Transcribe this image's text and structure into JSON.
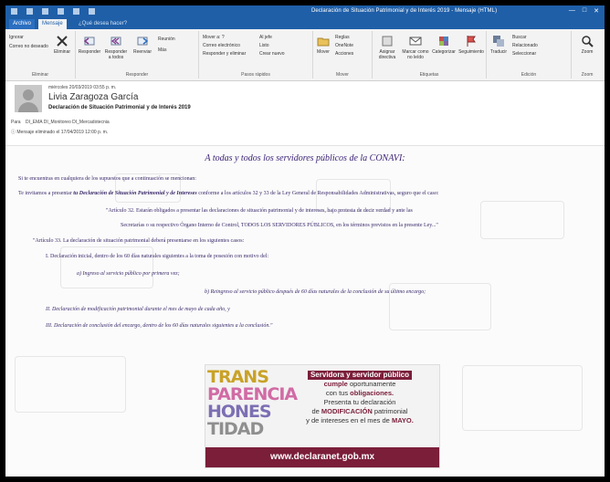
{
  "window": {
    "title": "Declaración de Situación Patrimonial y de Interés 2019 - Mensaje (HTML)",
    "controls": [
      "—",
      "□",
      "✕"
    ]
  },
  "ribbon": {
    "tabs": [
      "Archivo",
      "Mensaje"
    ],
    "tell_me": "¿Qué desea hacer?",
    "groups": [
      {
        "name": "Eliminar",
        "items": [
          "Ignorar",
          "Correo no deseado",
          "Eliminar"
        ]
      },
      {
        "name": "Responder",
        "items": [
          "Responder",
          "Responder a todos",
          "Reenviar",
          "Reunión",
          "Más"
        ]
      },
      {
        "name": "Pasos rápidos",
        "items": [
          "Mover a: ?",
          "Correo electrónico",
          "Responder y eliminar",
          "Al jefe",
          "Listo",
          "Crear nuevo"
        ]
      },
      {
        "name": "Mover",
        "items": [
          "Mover",
          "Reglas",
          "OneNote",
          "Acciones"
        ]
      },
      {
        "name": "Etiquetas",
        "items": [
          "Asignar directiva",
          "Marcar como no leído",
          "Categorizar",
          "Seguimiento"
        ]
      },
      {
        "name": "Edición",
        "items": [
          "Traducir",
          "Buscar",
          "Relacionado",
          "Seleccionar"
        ]
      },
      {
        "name": "Zoom",
        "items": [
          "Zoom"
        ]
      }
    ]
  },
  "message": {
    "date": "miércoles 20/03/2019 03:55 p. m.",
    "sender": "Livia Zaragoza García",
    "subject": "Declaración de Situación Patrimonial y de Interés 2019",
    "to_label": "Para",
    "to": "DI_EMA  DI_Monitoreo  DI_Mercadotecnia",
    "retention": "Mensaje eliminado el 17/04/2019 12:00 p. m."
  },
  "email_body": {
    "title": "A todas y todos los servidores públicos de la CONAVI:",
    "p1": "Si te encuentras en cualquiera de los supuestos que a continuación se mencionan:",
    "p2_a": "Te invitamos a presentar",
    "p2_b": "tu Declaración de Situación Patrimonial y de Intereses",
    "p2_c": "conforme a los artículos 32 y 33 de la Ley General de Responsabilidades Administrativas, seguro que el caso:",
    "q1": "\"Artículo 32. Estarán obligados a presentar las declaraciones de situación patrimonial y de intereses, bajo protesta de decir verdad y ante las",
    "q2": "Secretarías o su respectivo Órgano Interno de Control, TODOS LOS SERVIDORES PÚBLICOS, en los términos previstos en la presente Ley...\"",
    "a33": "\"Artículo 33. La declaración de situación patrimonial deberá presentarse en los siguientes casos:",
    "i1": "I. Declaración inicial, dentro de los 60 días naturales siguientes a la toma de posesión con motivo del:",
    "ia": "a)   Ingreso al servicio público por primera vez;",
    "ib": "b)   Reingreso al servicio público después de 60 días naturales de la conclusión de su último encargo;",
    "i2": "II. Declaración de modificación patrimonial durante el mes de mayo de cada año, y",
    "i3": "III. Declaración de conclusión del encargo, dentro de los 60 días naturales siguientes a la conclusión.\""
  },
  "banner": {
    "left_letters": [
      "TRANS",
      "PARENCIA",
      "HONES",
      "TIDAD"
    ],
    "line1": "Servidora y servidor público",
    "line2a": "cumple",
    "line2b": " oportunamente",
    "line3a": "con tus ",
    "line3b": "obligaciones.",
    "line4": "Presenta tu declaración",
    "line5a": "de ",
    "line5b": "MODIFICACIÓN",
    "line5c": " patrimonial",
    "line6a": "y de intereses en el mes de ",
    "line6b": "MAYO.",
    "url": "www.declaranet.gob.mx",
    "colors": {
      "maroon": "#7b1e3a",
      "gold": "#c9a227",
      "pink": "#d16ba5",
      "purple": "#7d6fb3",
      "gray": "#8f8f8f"
    }
  }
}
